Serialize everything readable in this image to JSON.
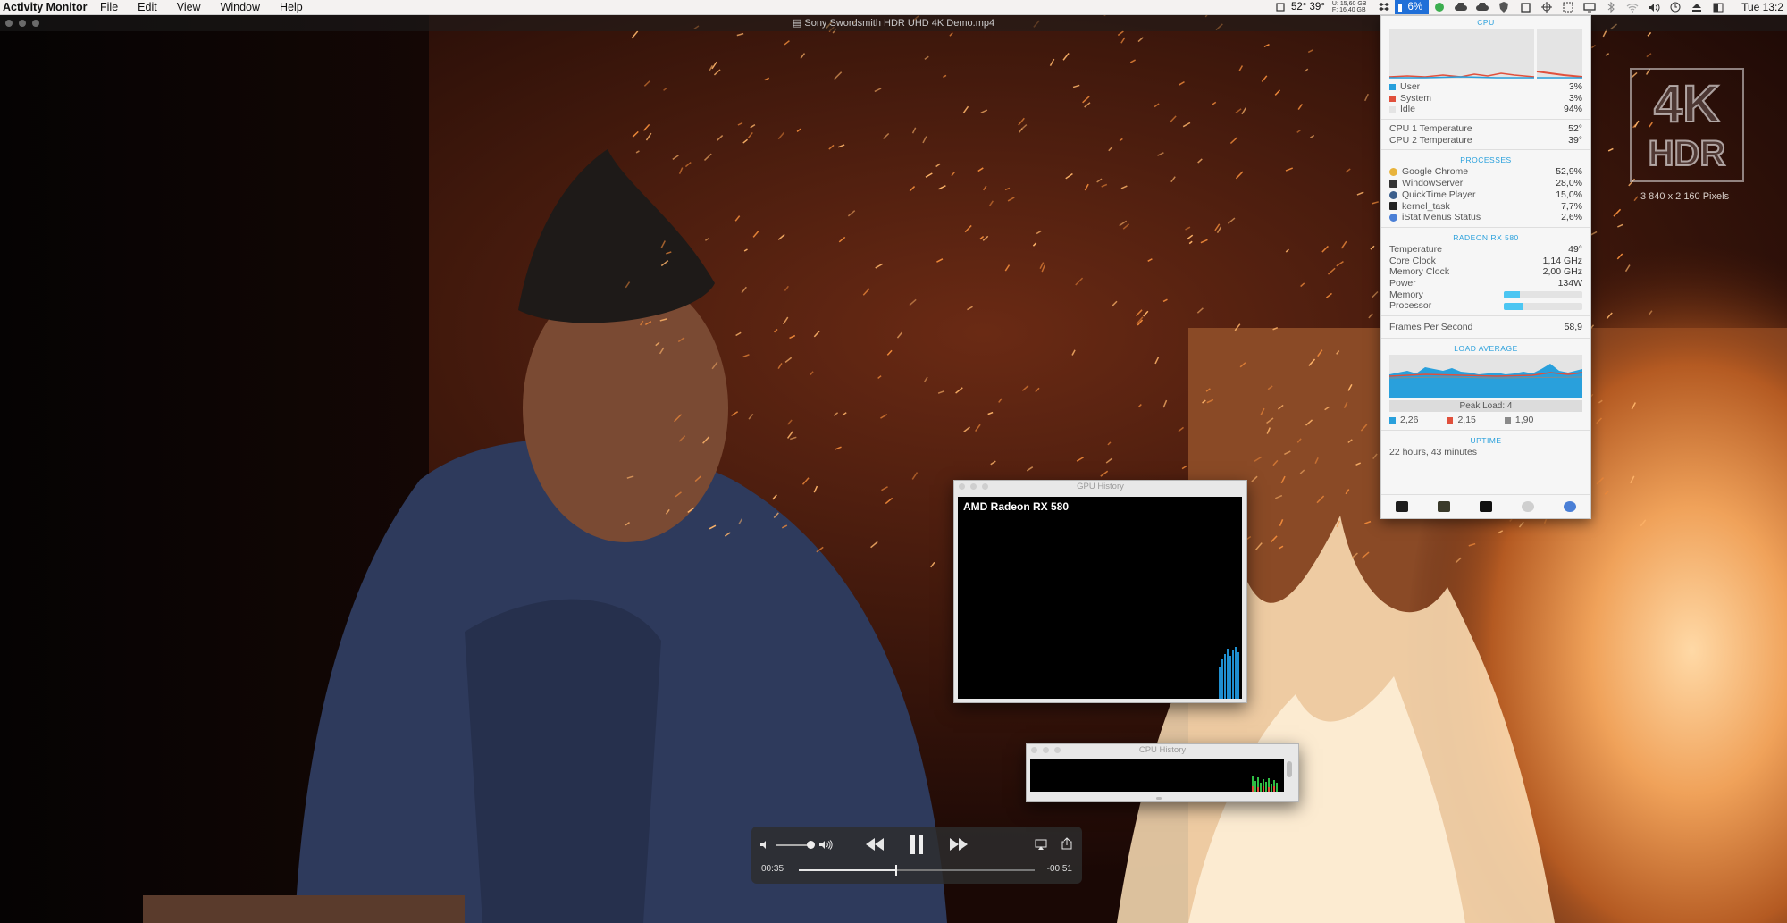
{
  "menubar": {
    "app_name": "Activity Monitor",
    "menus": [
      "File",
      "Edit",
      "View",
      "Window",
      "Help"
    ],
    "temps": "52° 39°",
    "disk_line1": "U: 15,60 GB",
    "disk_line2": "F: 16,40 GB",
    "cpu_percent": "6%",
    "clock": "Tue 13:2"
  },
  "video": {
    "title": "Sony Swordsmith HDR UHD 4K Demo.mp4",
    "badge_top": "4K",
    "badge_bottom": "HDR",
    "badge_resolution": "3 840 x 2 160 Pixels"
  },
  "istat": {
    "cpu_title": "CPU",
    "cpu_rows": [
      {
        "label": "User",
        "value": "3%",
        "color": "#29a0dc"
      },
      {
        "label": "System",
        "value": "3%",
        "color": "#e0503c"
      },
      {
        "label": "Idle",
        "value": "94%",
        "color": "#e4e4e4"
      }
    ],
    "temps": [
      {
        "label": "CPU 1 Temperature",
        "value": "52°"
      },
      {
        "label": "CPU 2 Temperature",
        "value": "39°"
      }
    ],
    "processes_title": "PROCESSES",
    "processes": [
      {
        "name": "Google Chrome",
        "value": "52,9%",
        "icon": "chrome-icon",
        "color": "#e8b33b"
      },
      {
        "name": "WindowServer",
        "value": "28,0%",
        "icon": "window-server-icon",
        "color": "#333333"
      },
      {
        "name": "QuickTime Player",
        "value": "15,0%",
        "icon": "quicktime-icon",
        "color": "#3c5f8c"
      },
      {
        "name": "kernel_task",
        "value": "7,7%",
        "icon": "terminal-icon",
        "color": "#222222"
      },
      {
        "name": "iStat Menus Status",
        "value": "2,6%",
        "icon": "istat-icon",
        "color": "#4a7fd6"
      }
    ],
    "gpu_title": "RADEON RX 580",
    "gpu_rows": [
      {
        "label": "Temperature",
        "value": "49°"
      },
      {
        "label": "Core Clock",
        "value": "1,14 GHz"
      },
      {
        "label": "Memory Clock",
        "value": "2,00 GHz"
      },
      {
        "label": "Power",
        "value": "134W"
      }
    ],
    "gpu_bars": [
      {
        "label": "Memory",
        "level": 0.2
      },
      {
        "label": "Processor",
        "level": 0.24
      }
    ],
    "fps_label": "Frames Per Second",
    "fps_value": "58,9",
    "load_title": "LOAD AVERAGE",
    "peak_load": "Peak Load: 4",
    "loads": [
      {
        "value": "2,26",
        "color": "#29a0dc"
      },
      {
        "value": "2,15",
        "color": "#e0503c"
      },
      {
        "value": "1,90",
        "color": "#8a8a8a"
      }
    ],
    "uptime_title": "UPTIME",
    "uptime": "22 hours, 43 minutes"
  },
  "gpu_history": {
    "window_title": "GPU History",
    "device": "AMD Radeon RX 580"
  },
  "cpu_history": {
    "window_title": "CPU History"
  },
  "player": {
    "elapsed": "00:35",
    "remaining": "-00:51",
    "progress": 0.41,
    "volume": 0.8
  }
}
